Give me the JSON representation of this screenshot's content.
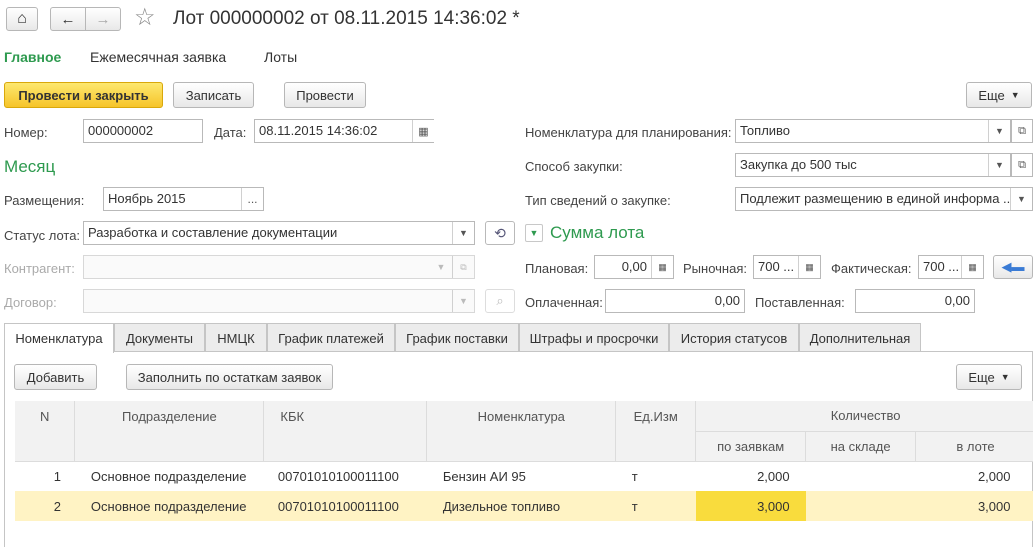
{
  "title": "Лот 000000002 от 08.11.2015 14:36:02 *",
  "nav": {
    "home": "⌂",
    "back": "←",
    "forward": "→",
    "star": "☆"
  },
  "top_tabs": [
    "Главное",
    "Ежемесячная заявка",
    "Лоты"
  ],
  "toolbar": {
    "post_close": "Провести и закрыть",
    "save": "Записать",
    "post": "Провести",
    "more": "Еще"
  },
  "form": {
    "number_label": "Номер:",
    "number_value": "000000002",
    "date_label": "Дата:",
    "date_value": "08.11.2015 14:36:02",
    "month_header": "Месяц",
    "placement_label": "Размещения:",
    "placement_value": "Ноябрь 2015",
    "placement_btn": "...",
    "status_label": "Статус лота:",
    "status_value": "Разработка и составление документации",
    "contractor_label": "Контрагент:",
    "contractor_value": "",
    "contract_label": "Договор:",
    "contract_value": "",
    "nomenclature_label": "Номенклатура для планирования:",
    "nomenclature_value": "Топливо",
    "method_label": "Способ закупки:",
    "method_value": "Закупка до 500 тыс",
    "info_type_label": "Тип сведений о закупке:",
    "info_type_value": "Подлежит размещению в единой информа ...",
    "sum_header": "Сумма лота",
    "planned_label": "Плановая:",
    "planned_value": "0,00",
    "market_label": "Рыночная:",
    "market_value": "700 ...",
    "actual_label": "Фактическая:",
    "actual_value": "700 ...",
    "paid_label": "Оплаченная:",
    "paid_value": "0,00",
    "delivered_label": "Поставленная:",
    "delivered_value": "0,00"
  },
  "tabs": [
    "Номенклатура",
    "Документы",
    "НМЦК",
    "График платежей",
    "График поставки",
    "Штрафы и просрочки",
    "История статусов",
    "Дополнительная"
  ],
  "table_toolbar": {
    "add": "Добавить",
    "fill": "Заполнить по остаткам заявок",
    "more": "Еще"
  },
  "table": {
    "headers": {
      "n": "N",
      "division": "Подразделение",
      "kbk": "КБК",
      "nomenclature": "Номенклатура",
      "unit": "Ед.Изм",
      "quantity": "Количество",
      "by_requests": "по заявкам",
      "in_stock": "на складе",
      "in_lot": "в лоте"
    },
    "rows": [
      {
        "n": "1",
        "division": "Основное подразделение",
        "kbk": "00701010100011100",
        "nomenclature": "Бензин АИ 95",
        "unit": "т",
        "by_requests": "2,000",
        "in_stock": "",
        "in_lot": "2,000"
      },
      {
        "n": "2",
        "division": "Основное подразделение",
        "kbk": "00701010100011100",
        "nomenclature": "Дизельное топливо",
        "unit": "т",
        "by_requests": "3,000",
        "in_stock": "",
        "in_lot": "3,000"
      }
    ]
  },
  "colors": {
    "accent_green": "#2e9a4f",
    "primary_yellow": "#f6c42a",
    "selected_row": "#fff3c4"
  }
}
